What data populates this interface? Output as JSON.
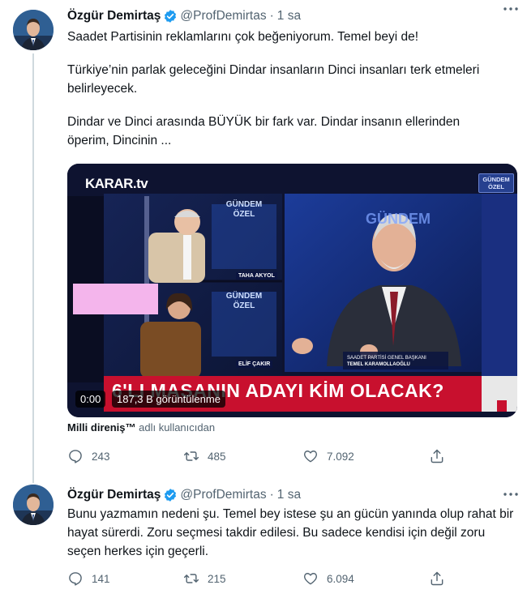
{
  "tweets": [
    {
      "author_name": "Özgür Demirtaş",
      "author_handle": "@ProfDemirtas",
      "separator": "·",
      "time": "1 sa",
      "text_lines": [
        "Saadet Partisinin reklamlarını çok beğeniyorum. Temel beyi de!",
        "Türkiye’nin parlak geleceğini Dindar insanların Dinci insanları terk etmeleri belirleyecek.",
        "Dindar ve Dinci arasında BÜYÜK bir fark var. Dindar insanın ellerinden öperim, Dincinin ..."
      ],
      "video": {
        "channel_logo": "KARAR.tv",
        "corner_badge_line1": "GÜNDEM",
        "corner_badge_line2": "ÖZEL",
        "studio_text_line1": "GÜNDEM",
        "studio_text_line2": "ÖZEL",
        "guest1_name": "TAHA AKYOL",
        "guest2_name": "ELİF ÇAKIR",
        "main_caption_title": "SAADET PARTİSİ GENEL BAŞKANI",
        "main_caption_name": "TEMEL KARAMOLLAOĞLU",
        "headline": "6'LI MASANIN ADAYI KİM OLACAK?",
        "elapsed_time": "0:00",
        "view_count": "187,3 B görüntülenme"
      },
      "attribution_user": "Milli direniş™",
      "attribution_suffix": " adlı kullanıcıdan",
      "replies": "243",
      "retweets": "485",
      "likes": "7.092"
    },
    {
      "author_name": "Özgür Demirtaş",
      "author_handle": "@ProfDemirtas",
      "separator": "·",
      "time": "1 sa",
      "text_lines": [
        "Bunu yazmamın nedeni şu. Temel bey istese şu an gücün yanında olup rahat bir hayat sürerdi. Zoru seçmesi takdir edilesi. Bu sadece kendisi için değil zoru seçen herkes için geçerli."
      ],
      "replies": "141",
      "retweets": "215",
      "likes": "6.094"
    }
  ],
  "colors": {
    "text_primary": "#0f1419",
    "text_secondary": "#536471",
    "verified_blue": "#1d9bf0",
    "thread_line": "#cfd9de",
    "headline_red": "#c8102e"
  },
  "icons": [
    "verified-badge-icon",
    "more-options-icon",
    "reply-icon",
    "retweet-icon",
    "like-icon",
    "share-icon"
  ]
}
